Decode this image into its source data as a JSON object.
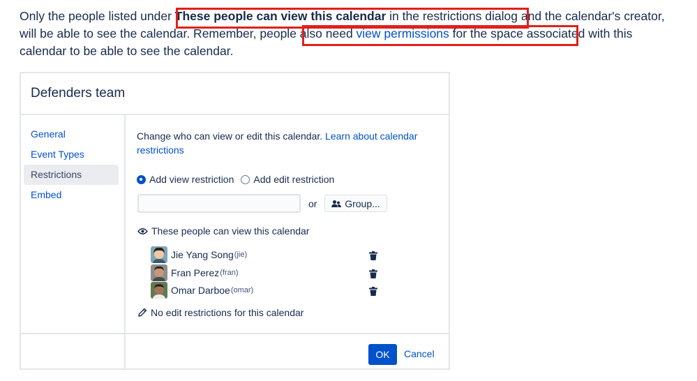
{
  "intro": {
    "text1": "Only the people listed under ",
    "bold": "These people can view this calendar",
    "text2": " in the restrictions dialog",
    "text3": " and the calendar's creator, will be able to see the calendar. Remember, ",
    "text4": "people also need ",
    "link": "view permissions",
    "text5": " for the space",
    "text6": " associated with this calendar to be able to see the calendar.",
    "highlight_color": "#e0201b"
  },
  "dialog": {
    "title": "Defenders team",
    "sidebar": {
      "items": [
        {
          "label": "General",
          "active": false
        },
        {
          "label": "Event Types",
          "active": false
        },
        {
          "label": "Restrictions",
          "active": true
        },
        {
          "label": "Embed",
          "active": false
        }
      ]
    },
    "content": {
      "description": "Change who can view or edit this calendar. ",
      "learn_link": "Learn about calendar restrictions",
      "radio_view": "Add view restriction",
      "radio_edit": "Add edit restriction",
      "input_value": "",
      "or_label": "or",
      "group_button": "Group...",
      "view_header": "These people can view this calendar",
      "people": [
        {
          "name": "Jie Yang Song",
          "username": "(jie)"
        },
        {
          "name": "Fran Perez",
          "username": "(fran)"
        },
        {
          "name": "Omar Darboe",
          "username": "(omar)"
        }
      ],
      "edit_note": "No edit restrictions for this calendar"
    },
    "footer": {
      "ok": "OK",
      "cancel": "Cancel"
    },
    "colors": {
      "accent": "#0052cc",
      "border": "#e4e6ea"
    }
  }
}
